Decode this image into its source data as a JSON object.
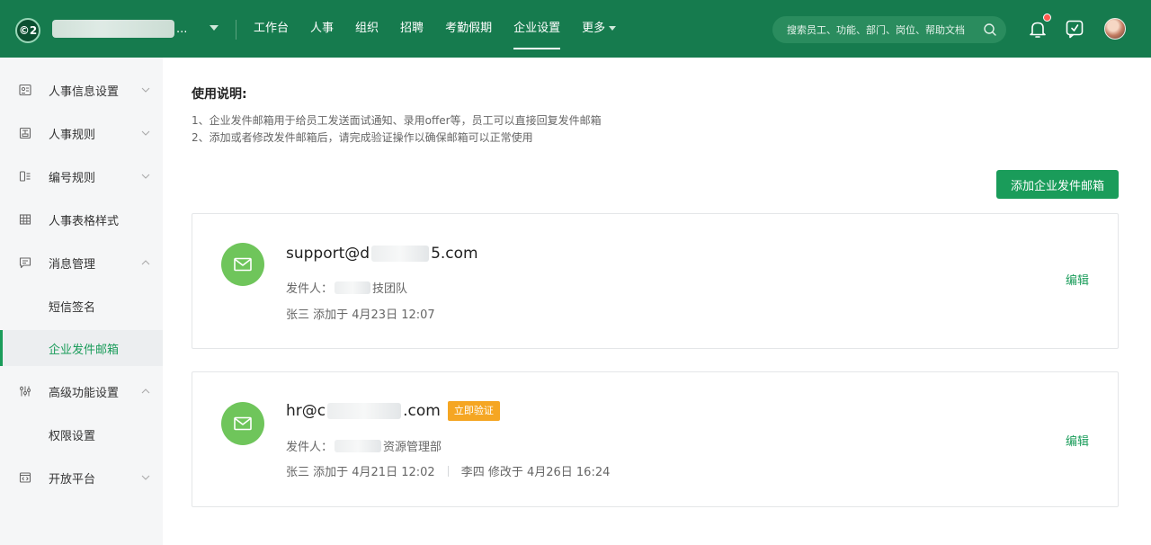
{
  "header": {
    "logo_text": "©2",
    "company_ellipsis": "...",
    "nav": [
      {
        "label": "工作台"
      },
      {
        "label": "人事"
      },
      {
        "label": "组织"
      },
      {
        "label": "招聘"
      },
      {
        "label": "考勤假期"
      },
      {
        "label": "企业设置",
        "active": true
      },
      {
        "label": "更多"
      }
    ],
    "search_placeholder": "搜索员工、功能、部门、岗位、帮助文档",
    "notification_badge_color": "#ff5a4f",
    "icons": [
      "bell-icon",
      "feedback-icon",
      "avatar"
    ]
  },
  "sidebar": {
    "items": [
      {
        "label": "人事信息设置",
        "icon": "id-card-icon",
        "chevron": "down"
      },
      {
        "label": "人事规则",
        "icon": "rules-icon",
        "chevron": "down"
      },
      {
        "label": "编号规则",
        "icon": "numbering-icon",
        "chevron": "down"
      },
      {
        "label": "人事表格样式",
        "icon": "table-icon"
      },
      {
        "label": "消息管理",
        "icon": "message-icon",
        "chevron": "up"
      },
      {
        "label": "短信签名",
        "sub": true
      },
      {
        "label": "企业发件邮箱",
        "sub": true,
        "active": true
      },
      {
        "label": "高级功能设置",
        "icon": "sliders-icon",
        "chevron": "up"
      },
      {
        "label": "权限设置",
        "sub": true
      },
      {
        "label": "开放平台",
        "icon": "code-icon",
        "chevron": "down"
      }
    ]
  },
  "main": {
    "usage_title": "使用说明:",
    "usage_lines": [
      "1、企业发件邮箱用于给员工发送面试通知、录用offer等，员工可以直接回复发件邮箱",
      "2、添加或者修改发件邮箱后，请完成验证操作以确保邮箱可以正常使用"
    ],
    "add_button": "添加企业发件邮箱",
    "cards": [
      {
        "email_prefix": "support@d",
        "email_suffix": "5.com",
        "sender_label": "发件人：",
        "sender_suffix": "技团队",
        "meta_added": "张三 添加于 4月23日 12:07",
        "edit_label": "编辑"
      },
      {
        "email_prefix": "hr@c",
        "email_suffix": ".com",
        "verify_label": "立即验证",
        "sender_label": "发件人：",
        "sender_suffix": "资源管理部",
        "meta_added": "张三 添加于 4月21日 12:02",
        "meta_modified": "李四 修改于 4月26日 16:24",
        "edit_label": "编辑"
      }
    ]
  },
  "colors": {
    "header_bg": "#167b4e",
    "accent": "#1a9c5a",
    "mail_icon_bg": "#6fc55b",
    "verify_badge": "#f5a623"
  }
}
